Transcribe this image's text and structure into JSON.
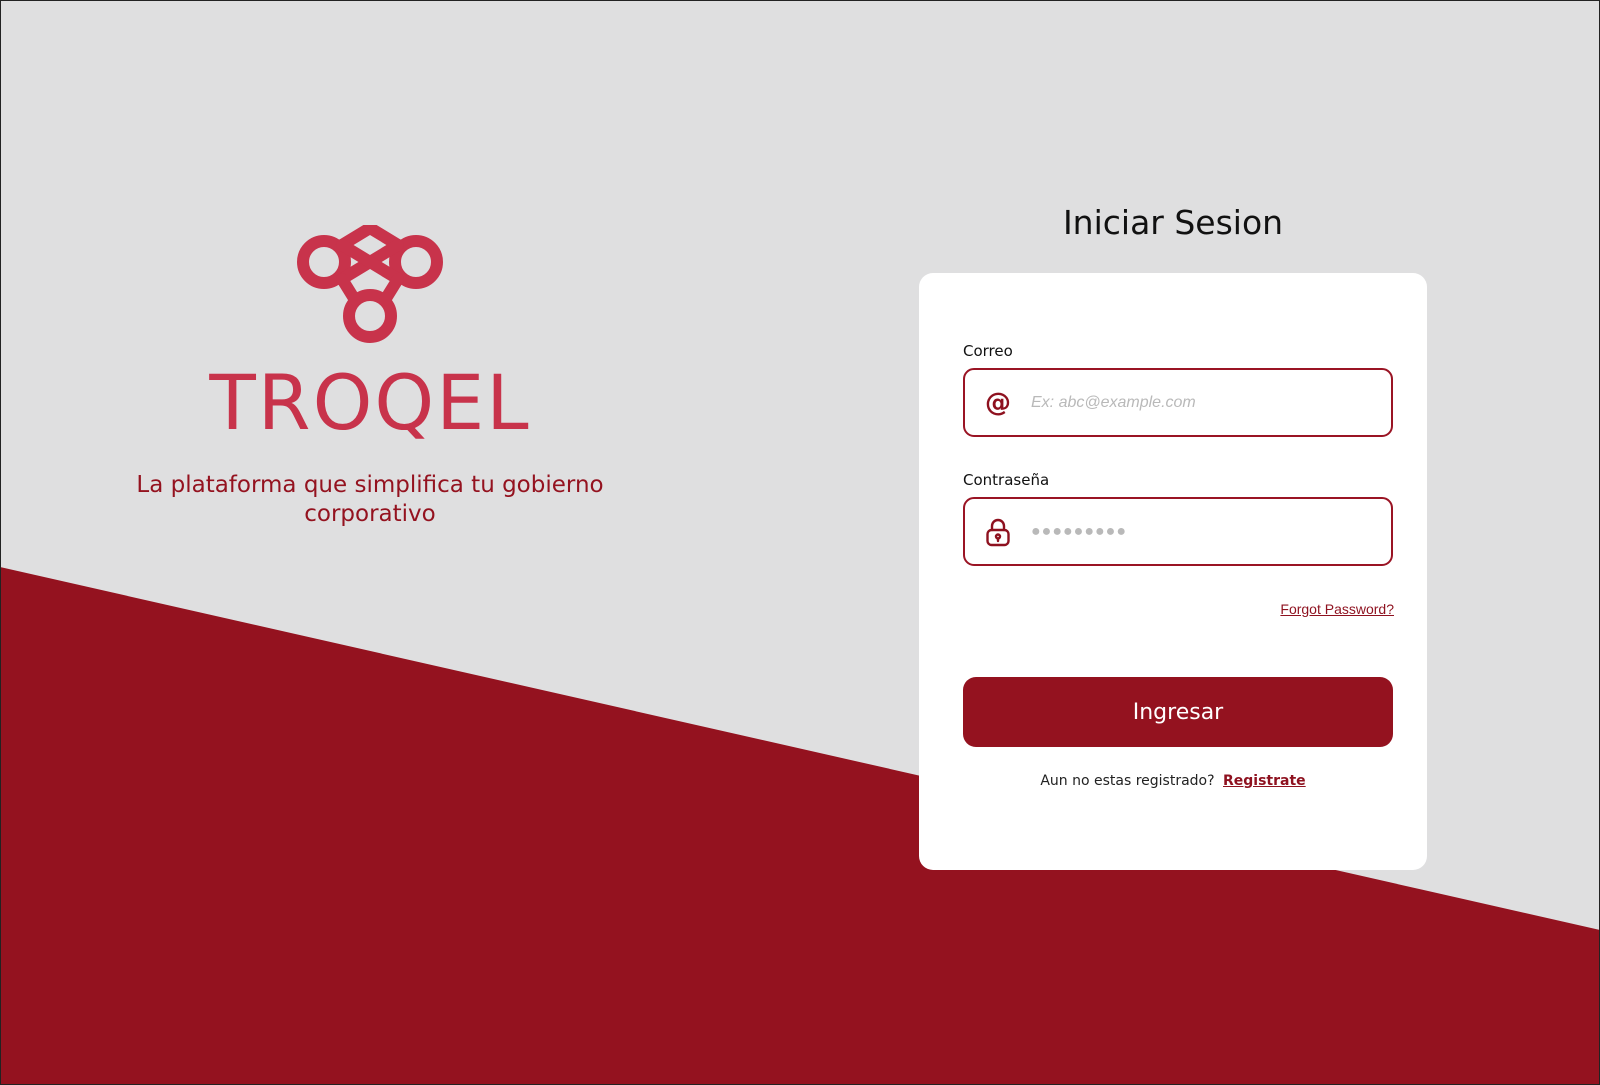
{
  "colors": {
    "background": "#dfdfe0",
    "accent_dark": "#94121f",
    "brand_logo": "#c8334b",
    "card": "#ffffff"
  },
  "brand": {
    "logo_icon": "troqel-knot-logo",
    "name": "TROQEL",
    "tagline": "La plataforma que simplifica tu gobierno corporativo"
  },
  "login": {
    "title": "Iniciar Sesion",
    "email": {
      "label": "Correo",
      "icon": "at-icon",
      "icon_glyph": "@",
      "placeholder": "Ex: abc@example.com",
      "value": ""
    },
    "password": {
      "label": "Contraseña",
      "icon": "lock-icon",
      "placeholder": "●●●●●●●●●",
      "value": ""
    },
    "forgot_label": "Forgot Password?",
    "submit_label": "Ingresar",
    "register_prompt": "Aun no estas registrado?",
    "register_link": "Registrate"
  }
}
